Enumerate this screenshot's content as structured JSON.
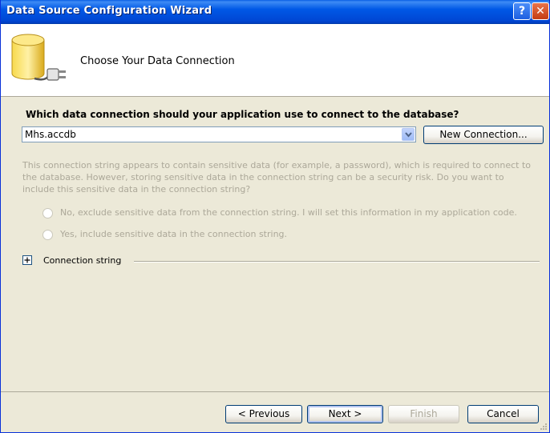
{
  "window": {
    "title": "Data Source Configuration Wizard",
    "help_glyph": "?",
    "close_glyph": "✕"
  },
  "header": {
    "title": "Choose Your Data Connection",
    "icon": "database-plug-icon"
  },
  "connection": {
    "question": "Which data connection should your application use to connect to the database?",
    "selected_value": "Mhs.accdb",
    "new_connection_label": "New Connection..."
  },
  "sensitive": {
    "info": "This connection string appears to contain sensitive data (for example, a password), which is required to connect to the database. However, storing sensitive data in the connection string can be a security risk. Do you want to include this sensitive data in the connection string?",
    "option_exclude": "No, exclude sensitive data from the connection string. I will set this information in my application code.",
    "option_include": "Yes, include sensitive data in the connection string.",
    "enabled": false
  },
  "connection_string": {
    "label": "Connection string",
    "expanded": false
  },
  "footer": {
    "previous_label": "< Previous",
    "next_label": "Next >",
    "finish_label": "Finish",
    "cancel_label": "Cancel"
  },
  "colors": {
    "titlebar": "#0058e6",
    "dialog_bg": "#ece9d8",
    "disabled_text": "#aca899"
  }
}
